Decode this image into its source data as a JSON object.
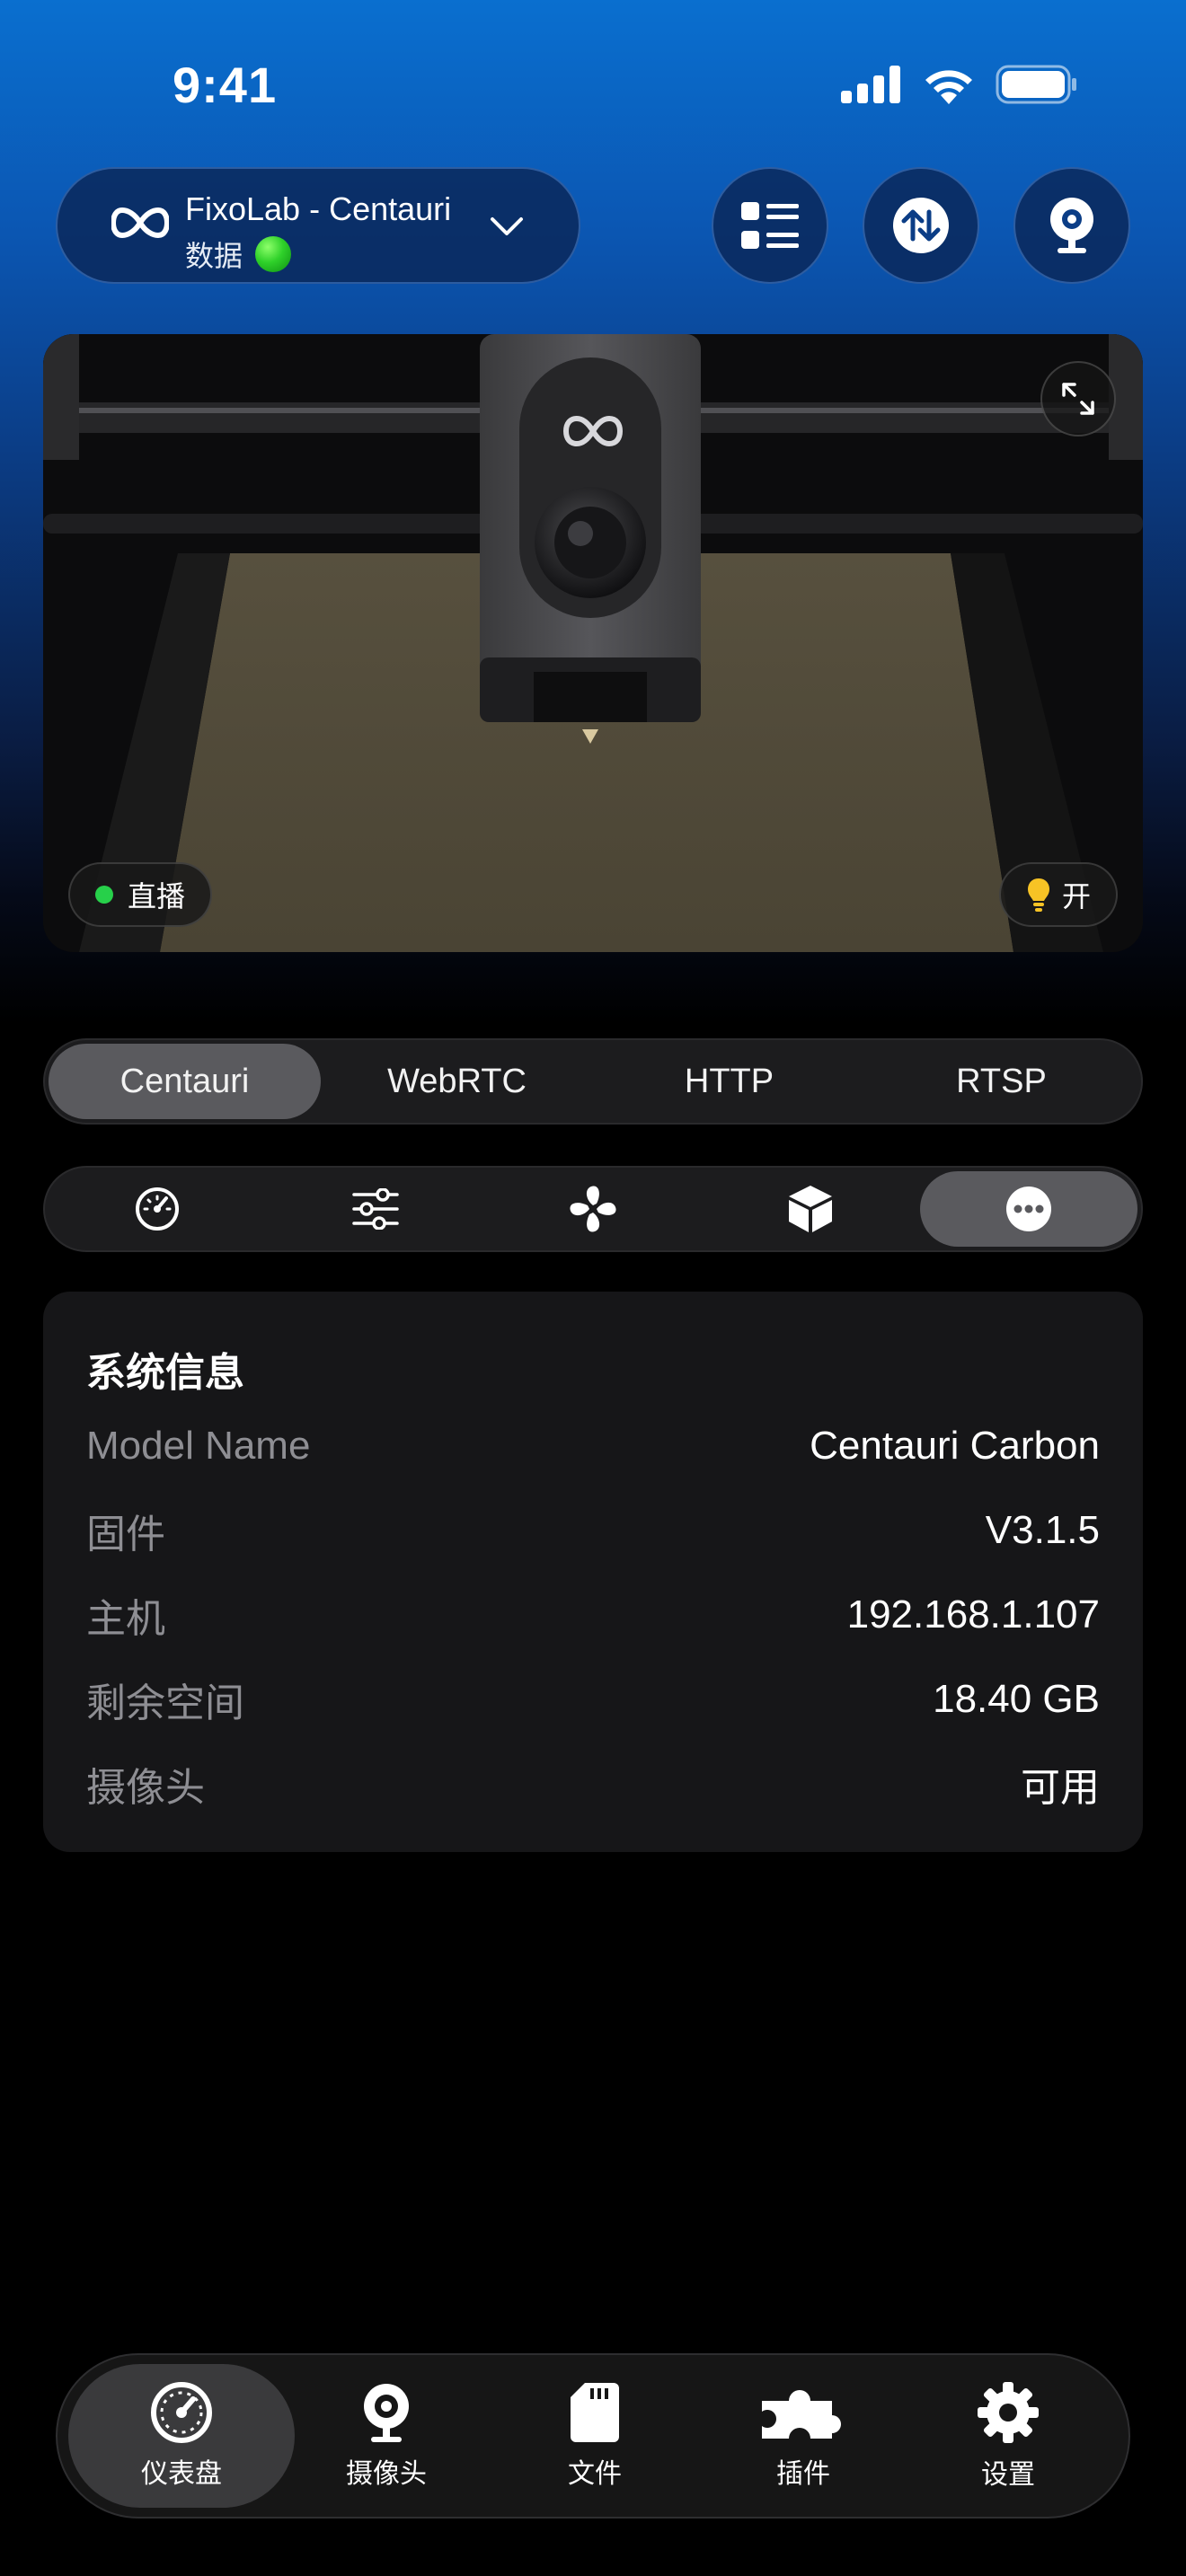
{
  "status_bar": {
    "time": "9:41"
  },
  "header": {
    "printer_name": "FixoLab - Centauri",
    "printer_sub": "数据",
    "status_color": "#2fd12a"
  },
  "camera": {
    "live_label": "直播",
    "light_label": "开"
  },
  "stream_tabs": [
    {
      "label": "Centauri",
      "active": true
    },
    {
      "label": "WebRTC",
      "active": false
    },
    {
      "label": "HTTP",
      "active": false
    },
    {
      "label": "RTSP",
      "active": false
    }
  ],
  "tool_tabs": [
    {
      "icon": "gauge-icon",
      "active": false
    },
    {
      "icon": "sliders-icon",
      "active": false
    },
    {
      "icon": "fan-icon",
      "active": false
    },
    {
      "icon": "cube-icon",
      "active": false
    },
    {
      "icon": "more-icon",
      "active": true
    }
  ],
  "system_info": {
    "title": "系统信息",
    "rows": [
      {
        "label": "Model Name",
        "value": "Centauri Carbon"
      },
      {
        "label": "固件",
        "value": "V3.1.5"
      },
      {
        "label": "主机",
        "value": "192.168.1.107"
      },
      {
        "label": "剩余空间",
        "value": "18.40 GB"
      },
      {
        "label": "摄像头",
        "value": "可用"
      }
    ]
  },
  "tabbar": [
    {
      "label": "仪表盘",
      "icon": "dashboard-icon",
      "active": true
    },
    {
      "label": "摄像头",
      "icon": "webcam-icon",
      "active": false
    },
    {
      "label": "文件",
      "icon": "sd-card-icon",
      "active": false
    },
    {
      "label": "插件",
      "icon": "puzzle-icon",
      "active": false
    },
    {
      "label": "设置",
      "icon": "gear-icon",
      "active": false
    }
  ],
  "colors": {
    "accent_blue": "#0b56b2",
    "live_green": "#27d04a",
    "segment_active": "#5a5a5e"
  }
}
